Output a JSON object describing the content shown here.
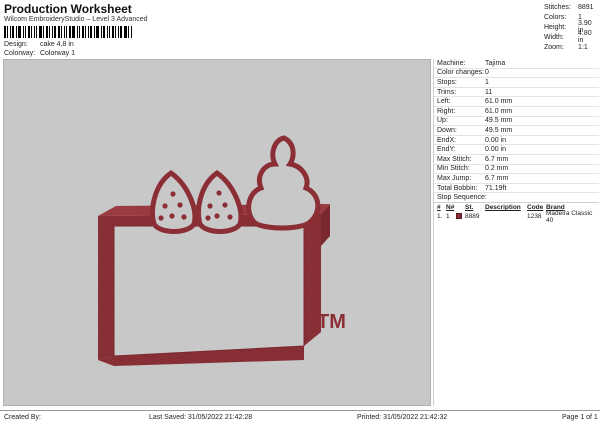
{
  "header": {
    "title": "Production Worksheet",
    "subtitle": "Wilcom EmbroideryStudio – Level 3 Advanced",
    "design_label": "Design:",
    "design_value": "cake 4,8 in",
    "colorway_label": "Colorway:",
    "colorway_value": "Colorway 1"
  },
  "summary": [
    {
      "key": "Stitches:",
      "value": "8891"
    },
    {
      "key": "Colors:",
      "value": "1"
    },
    {
      "key": "Height:",
      "value": "3.90 in"
    },
    {
      "key": "Width:",
      "value": "4.80 in"
    },
    {
      "key": "Zoom:",
      "value": "1:1"
    }
  ],
  "machine": [
    {
      "key": "Machine:",
      "value": "Tajima"
    },
    {
      "key": "Color changes:",
      "value": "0"
    },
    {
      "key": "Stops:",
      "value": "1"
    },
    {
      "key": "Trims:",
      "value": "11"
    },
    {
      "key": "Left:",
      "value": "61.0 mm"
    },
    {
      "key": "Right:",
      "value": "61.0 mm"
    },
    {
      "key": "Up:",
      "value": "49.5 mm"
    },
    {
      "key": "Down:",
      "value": "49.5 mm"
    },
    {
      "key": "EndX:",
      "value": "0.00 in"
    },
    {
      "key": "EndY:",
      "value": "0.00 in"
    },
    {
      "key": "Max Stitch:",
      "value": "6.7 mm"
    },
    {
      "key": "Min Stitch:",
      "value": "0.2 mm"
    },
    {
      "key": "Max Jump:",
      "value": "6.7 mm"
    },
    {
      "key": "Total Bobbin:",
      "value": "71.19ft"
    }
  ],
  "stop_sequence": {
    "title": "Stop Sequence:",
    "headers": {
      "n": "#",
      "nn": "N#",
      "st": "St.",
      "desc": "Description",
      "code": "Code",
      "brand": "Brand"
    },
    "rows": [
      {
        "n": "1.",
        "nn": "1",
        "color": "#8b2e35",
        "st": "8889",
        "desc": "",
        "code": "1238",
        "brand": "Madeira Classic 40"
      }
    ]
  },
  "design": {
    "thread_color": "#8b2e35",
    "trademark": "TM"
  },
  "footer": {
    "created": "Created By:",
    "saved": "Last Saved: 31/05/2022 21:42:28",
    "printed": "Printed: 31/05/2022 21:42:32",
    "page": "Page 1 of 1"
  }
}
